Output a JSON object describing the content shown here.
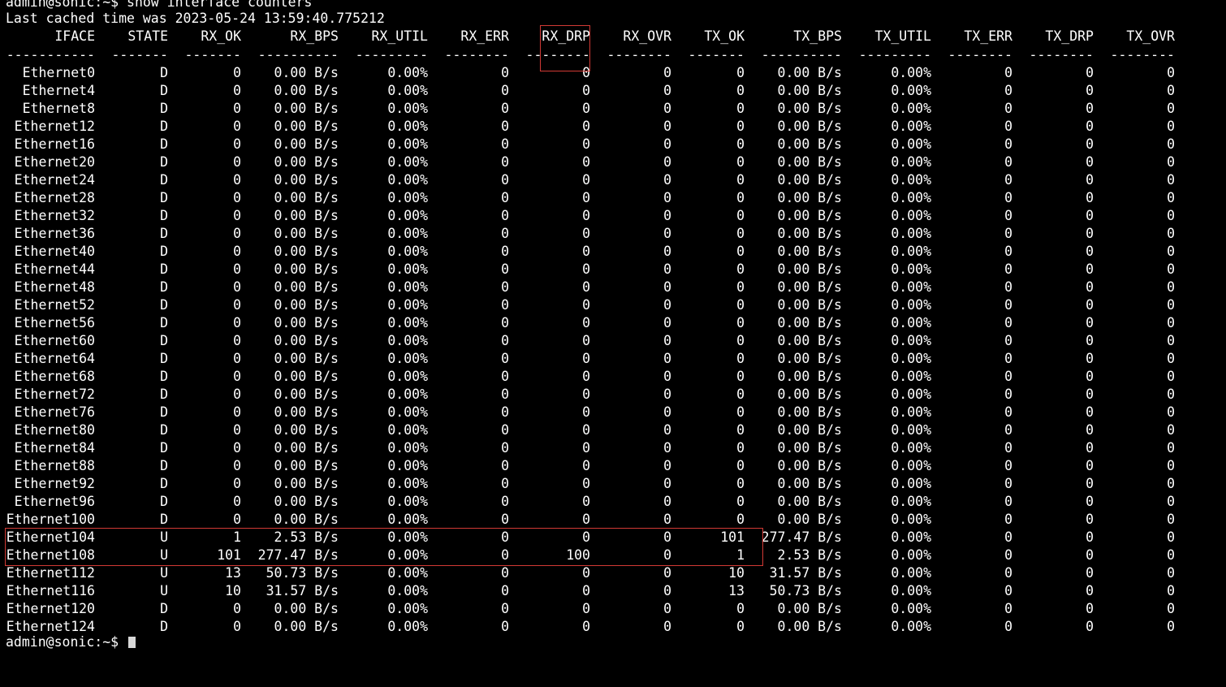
{
  "terminal": {
    "prompt_line": "admin@sonic:~$ show interface counters",
    "cache_line": "Last cached time was 2023-05-24 13:59:40.775212",
    "bottom_prompt": "admin@sonic:~$ ",
    "cursor_icon": "block-cursor-icon",
    "highlight_color": "#d23a35"
  },
  "table": {
    "headers": [
      "IFACE",
      "STATE",
      "RX_OK",
      "RX_BPS",
      "RX_UTIL",
      "RX_ERR",
      "RX_DRP",
      "RX_OVR",
      "TX_OK",
      "TX_BPS",
      "TX_UTIL",
      "TX_ERR",
      "TX_DRP",
      "TX_OVR"
    ],
    "separators": [
      "-----------",
      "-------",
      "-------",
      "----------",
      "---------",
      "--------",
      "--------",
      "--------",
      "-------",
      "----------",
      "---------",
      "--------",
      "--------",
      "--------"
    ],
    "rows": [
      [
        "Ethernet0",
        "D",
        "0",
        "0.00 B/s",
        "0.00%",
        "0",
        "0",
        "0",
        "0",
        "0.00 B/s",
        "0.00%",
        "0",
        "0",
        "0"
      ],
      [
        "Ethernet4",
        "D",
        "0",
        "0.00 B/s",
        "0.00%",
        "0",
        "0",
        "0",
        "0",
        "0.00 B/s",
        "0.00%",
        "0",
        "0",
        "0"
      ],
      [
        "Ethernet8",
        "D",
        "0",
        "0.00 B/s",
        "0.00%",
        "0",
        "0",
        "0",
        "0",
        "0.00 B/s",
        "0.00%",
        "0",
        "0",
        "0"
      ],
      [
        "Ethernet12",
        "D",
        "0",
        "0.00 B/s",
        "0.00%",
        "0",
        "0",
        "0",
        "0",
        "0.00 B/s",
        "0.00%",
        "0",
        "0",
        "0"
      ],
      [
        "Ethernet16",
        "D",
        "0",
        "0.00 B/s",
        "0.00%",
        "0",
        "0",
        "0",
        "0",
        "0.00 B/s",
        "0.00%",
        "0",
        "0",
        "0"
      ],
      [
        "Ethernet20",
        "D",
        "0",
        "0.00 B/s",
        "0.00%",
        "0",
        "0",
        "0",
        "0",
        "0.00 B/s",
        "0.00%",
        "0",
        "0",
        "0"
      ],
      [
        "Ethernet24",
        "D",
        "0",
        "0.00 B/s",
        "0.00%",
        "0",
        "0",
        "0",
        "0",
        "0.00 B/s",
        "0.00%",
        "0",
        "0",
        "0"
      ],
      [
        "Ethernet28",
        "D",
        "0",
        "0.00 B/s",
        "0.00%",
        "0",
        "0",
        "0",
        "0",
        "0.00 B/s",
        "0.00%",
        "0",
        "0",
        "0"
      ],
      [
        "Ethernet32",
        "D",
        "0",
        "0.00 B/s",
        "0.00%",
        "0",
        "0",
        "0",
        "0",
        "0.00 B/s",
        "0.00%",
        "0",
        "0",
        "0"
      ],
      [
        "Ethernet36",
        "D",
        "0",
        "0.00 B/s",
        "0.00%",
        "0",
        "0",
        "0",
        "0",
        "0.00 B/s",
        "0.00%",
        "0",
        "0",
        "0"
      ],
      [
        "Ethernet40",
        "D",
        "0",
        "0.00 B/s",
        "0.00%",
        "0",
        "0",
        "0",
        "0",
        "0.00 B/s",
        "0.00%",
        "0",
        "0",
        "0"
      ],
      [
        "Ethernet44",
        "D",
        "0",
        "0.00 B/s",
        "0.00%",
        "0",
        "0",
        "0",
        "0",
        "0.00 B/s",
        "0.00%",
        "0",
        "0",
        "0"
      ],
      [
        "Ethernet48",
        "D",
        "0",
        "0.00 B/s",
        "0.00%",
        "0",
        "0",
        "0",
        "0",
        "0.00 B/s",
        "0.00%",
        "0",
        "0",
        "0"
      ],
      [
        "Ethernet52",
        "D",
        "0",
        "0.00 B/s",
        "0.00%",
        "0",
        "0",
        "0",
        "0",
        "0.00 B/s",
        "0.00%",
        "0",
        "0",
        "0"
      ],
      [
        "Ethernet56",
        "D",
        "0",
        "0.00 B/s",
        "0.00%",
        "0",
        "0",
        "0",
        "0",
        "0.00 B/s",
        "0.00%",
        "0",
        "0",
        "0"
      ],
      [
        "Ethernet60",
        "D",
        "0",
        "0.00 B/s",
        "0.00%",
        "0",
        "0",
        "0",
        "0",
        "0.00 B/s",
        "0.00%",
        "0",
        "0",
        "0"
      ],
      [
        "Ethernet64",
        "D",
        "0",
        "0.00 B/s",
        "0.00%",
        "0",
        "0",
        "0",
        "0",
        "0.00 B/s",
        "0.00%",
        "0",
        "0",
        "0"
      ],
      [
        "Ethernet68",
        "D",
        "0",
        "0.00 B/s",
        "0.00%",
        "0",
        "0",
        "0",
        "0",
        "0.00 B/s",
        "0.00%",
        "0",
        "0",
        "0"
      ],
      [
        "Ethernet72",
        "D",
        "0",
        "0.00 B/s",
        "0.00%",
        "0",
        "0",
        "0",
        "0",
        "0.00 B/s",
        "0.00%",
        "0",
        "0",
        "0"
      ],
      [
        "Ethernet76",
        "D",
        "0",
        "0.00 B/s",
        "0.00%",
        "0",
        "0",
        "0",
        "0",
        "0.00 B/s",
        "0.00%",
        "0",
        "0",
        "0"
      ],
      [
        "Ethernet80",
        "D",
        "0",
        "0.00 B/s",
        "0.00%",
        "0",
        "0",
        "0",
        "0",
        "0.00 B/s",
        "0.00%",
        "0",
        "0",
        "0"
      ],
      [
        "Ethernet84",
        "D",
        "0",
        "0.00 B/s",
        "0.00%",
        "0",
        "0",
        "0",
        "0",
        "0.00 B/s",
        "0.00%",
        "0",
        "0",
        "0"
      ],
      [
        "Ethernet88",
        "D",
        "0",
        "0.00 B/s",
        "0.00%",
        "0",
        "0",
        "0",
        "0",
        "0.00 B/s",
        "0.00%",
        "0",
        "0",
        "0"
      ],
      [
        "Ethernet92",
        "D",
        "0",
        "0.00 B/s",
        "0.00%",
        "0",
        "0",
        "0",
        "0",
        "0.00 B/s",
        "0.00%",
        "0",
        "0",
        "0"
      ],
      [
        "Ethernet96",
        "D",
        "0",
        "0.00 B/s",
        "0.00%",
        "0",
        "0",
        "0",
        "0",
        "0.00 B/s",
        "0.00%",
        "0",
        "0",
        "0"
      ],
      [
        "Ethernet100",
        "D",
        "0",
        "0.00 B/s",
        "0.00%",
        "0",
        "0",
        "0",
        "0",
        "0.00 B/s",
        "0.00%",
        "0",
        "0",
        "0"
      ],
      [
        "Ethernet104",
        "U",
        "1",
        "2.53 B/s",
        "0.00%",
        "0",
        "0",
        "0",
        "101",
        "277.47 B/s",
        "0.00%",
        "0",
        "0",
        "0"
      ],
      [
        "Ethernet108",
        "U",
        "101",
        "277.47 B/s",
        "0.00%",
        "0",
        "100",
        "0",
        "1",
        "2.53 B/s",
        "0.00%",
        "0",
        "0",
        "0"
      ],
      [
        "Ethernet112",
        "U",
        "13",
        "50.73 B/s",
        "0.00%",
        "0",
        "0",
        "0",
        "10",
        "31.57 B/s",
        "0.00%",
        "0",
        "0",
        "0"
      ],
      [
        "Ethernet116",
        "U",
        "10",
        "31.57 B/s",
        "0.00%",
        "0",
        "0",
        "0",
        "13",
        "50.73 B/s",
        "0.00%",
        "0",
        "0",
        "0"
      ],
      [
        "Ethernet120",
        "D",
        "0",
        "0.00 B/s",
        "0.00%",
        "0",
        "0",
        "0",
        "0",
        "0.00 B/s",
        "0.00%",
        "0",
        "0",
        "0"
      ],
      [
        "Ethernet124",
        "D",
        "0",
        "0.00 B/s",
        "0.00%",
        "0",
        "0",
        "0",
        "0",
        "0.00 B/s",
        "0.00%",
        "0",
        "0",
        "0"
      ]
    ]
  }
}
